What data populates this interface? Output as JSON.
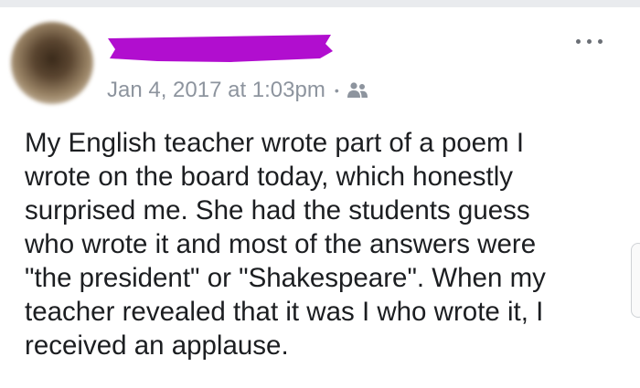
{
  "post": {
    "timestamp": "Jan 4, 2017 at 1:03pm",
    "separator": "•",
    "audience_icon": "friends-icon",
    "more_icon": "more-horizontal-icon",
    "redaction_color": "#b10ecf",
    "text_lines": [
      "My English teacher wrote part of a poem I",
      "wrote on the board today, which honestly",
      "surprised me. She had the students guess",
      "who wrote it and most of the answers were",
      "\"the president\" or \"Shakespeare\". When my",
      "teacher revealed that it was I who wrote it, I",
      "received an applause."
    ]
  }
}
